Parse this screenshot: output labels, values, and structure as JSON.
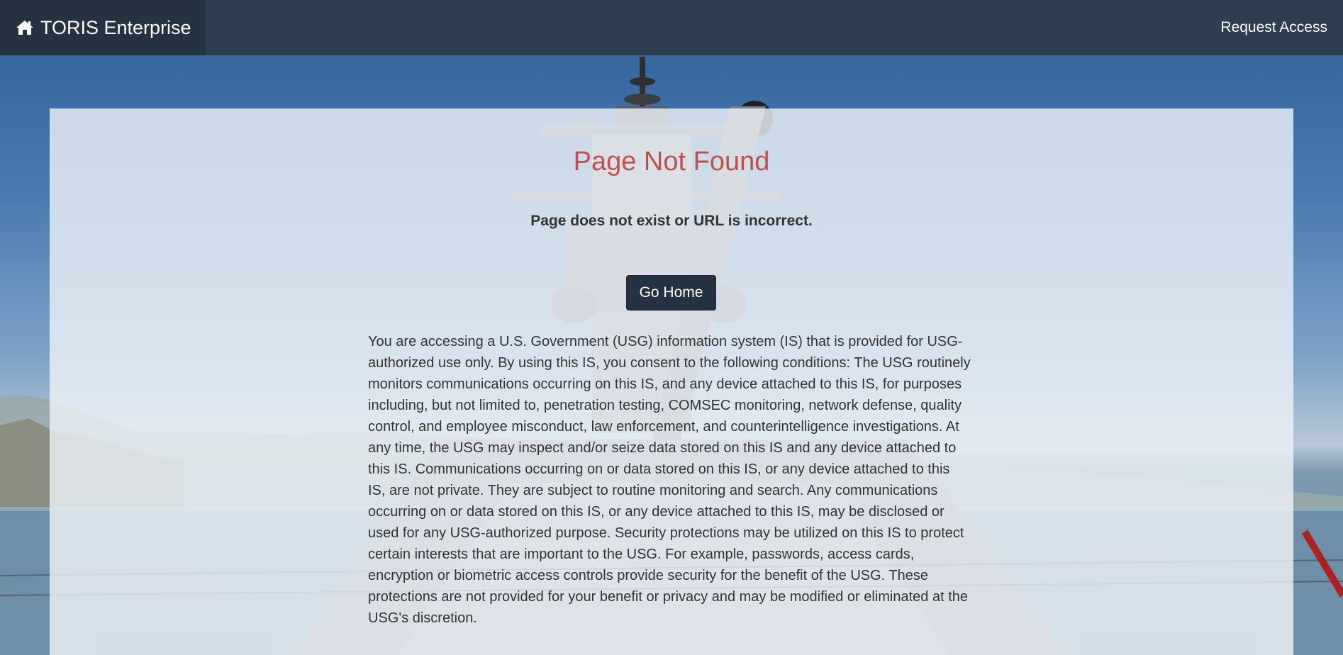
{
  "navbar": {
    "brand_label": "TORIS Enterprise",
    "brand_icon": "home-icon",
    "request_access_label": "Request Access"
  },
  "main": {
    "title": "Page Not Found",
    "subtitle": "Page does not exist or URL is incorrect.",
    "go_home_label": "Go Home",
    "disclaimer": "You are accessing a U.S. Government (USG) information system (IS) that is provided for USG-authorized use only. By using this IS, you consent to the following conditions: The USG routinely monitors communications occurring on this IS, and any device attached to this IS, for purposes including, but not limited to, penetration testing, COMSEC monitoring, network defense, quality control, and employee misconduct, law enforcement, and counterintelligence investigations. At any time, the USG may inspect and/or seize data stored on this IS and any device attached to this IS. Communications occurring on or data stored on this IS, or any device attached to this IS, are not private. They are subject to routine monitoring and search. Any communications occurring on or data stored on this IS, or any device attached to this IS, may be disclosed or used for any USG-authorized purpose. Security protections may be utilized on this IS to protect certain interests that are important to the USG. For example, passwords, access cards, encryption or biometric access controls provide security for the benefit of the USG. These protections are not provided for your benefit or privacy and may be modified or eliminated at the USG's discretion."
  },
  "colors": {
    "navbar_bg": "#2c3e50",
    "brand_bg": "#253241",
    "title_color": "#c0504d",
    "button_bg": "#253241"
  }
}
